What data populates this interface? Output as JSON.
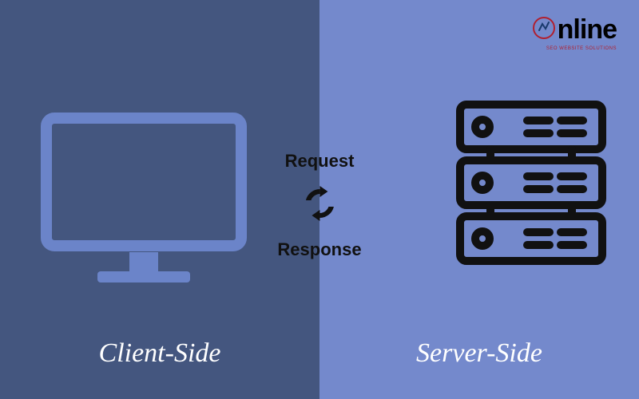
{
  "logo": {
    "text": "nline",
    "tagline": "SEO WEBSITE SOLUTIONS"
  },
  "left": {
    "caption": "Client-Side"
  },
  "right": {
    "caption": "Server-Side"
  },
  "middle": {
    "request_label": "Request",
    "response_label": "Response"
  },
  "icons": {
    "monitor": "monitor-icon",
    "server": "server-stack-icon",
    "refresh": "refresh-arrows-icon",
    "logo_mark": "logo-mark-icon"
  }
}
